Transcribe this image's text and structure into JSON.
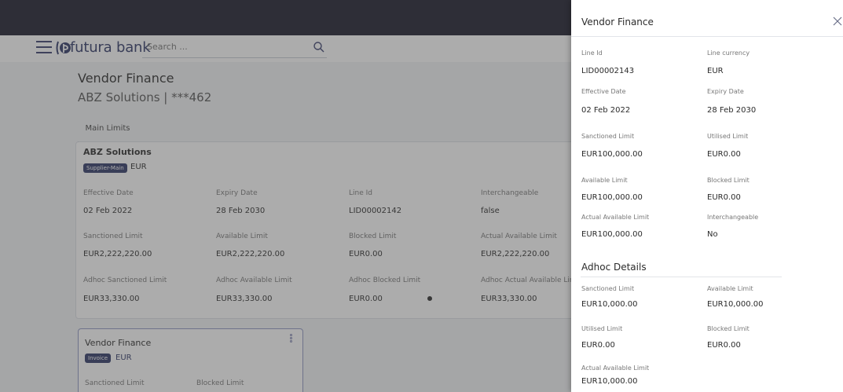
{
  "header": {
    "brand": "futura bank",
    "search_placeholder": "Search ..."
  },
  "page": {
    "title": "Vendor Finance",
    "subtitle": "ABZ Solutions | ***462",
    "tab": "Main Limits"
  },
  "main_card": {
    "title": "ABZ Solutions",
    "badge": "Supplier-Main",
    "currency": "EUR",
    "fields": [
      {
        "label": "Effective Date",
        "value": "02 Feb 2022"
      },
      {
        "label": "Expiry Date",
        "value": "28 Feb 2030"
      },
      {
        "label": "Line Id",
        "value": "LID00002142"
      },
      {
        "label": "Interchangeable",
        "value": "false"
      },
      {
        "label": "Sanctioned Limit",
        "value": "EUR2,222,220.00"
      },
      {
        "label": "Available Limit",
        "value": "EUR2,222,220.00"
      },
      {
        "label": "Blocked Limit",
        "value": "EUR0.00"
      },
      {
        "label": "Actual Available Limit",
        "value": "EUR2,222,220.00"
      },
      {
        "label": "Adhoc Sanctioned Limit",
        "value": "EUR33,330.00"
      },
      {
        "label": "Adhoc Available Limit",
        "value": "EUR33,330.00"
      },
      {
        "label": "Adhoc Blocked Limit",
        "value": "EUR0.00"
      },
      {
        "label": "Adhoc Actual Available Limi",
        "value": "EUR33,330.00"
      }
    ]
  },
  "vendor_card": {
    "title": "Vendor Finance",
    "badge": "Invoice",
    "currency": "EUR",
    "labels": [
      "Sanctioned Limit",
      "Blocked Limit"
    ]
  },
  "drawer": {
    "title": "Vendor Finance",
    "fields": [
      {
        "label": "Line Id",
        "value": "LID00002143"
      },
      {
        "label": "Line currency",
        "value": "EUR"
      },
      {
        "label": "Effective Date",
        "value": "02 Feb 2022"
      },
      {
        "label": "Expiry Date",
        "value": "28 Feb 2030"
      },
      {
        "label": "Sanctioned Limit",
        "value": "EUR100,000.00"
      },
      {
        "label": "Utilised Limit",
        "value": "EUR0.00"
      },
      {
        "label": "Available Limit",
        "value": "EUR100,000.00"
      },
      {
        "label": "Blocked Limit",
        "value": "EUR0.00"
      },
      {
        "label": "Actual Available Limit",
        "value": "EUR100,000.00"
      },
      {
        "label": "Interchangeable",
        "value": "No"
      }
    ],
    "adhoc_title": "Adhoc Details",
    "adhoc_fields": [
      {
        "label": "Sanctioned Limit",
        "value": "EUR10,000.00"
      },
      {
        "label": "Available Limit",
        "value": "EUR10,000.00"
      },
      {
        "label": "Utilised Limit",
        "value": "EUR0.00"
      },
      {
        "label": "Blocked Limit",
        "value": "EUR0.00"
      },
      {
        "label": "Actual Available Limit",
        "value": "EUR10,000.00"
      }
    ]
  },
  "colors": {
    "topbar": "#1b1b2b",
    "brand": "#2f3766",
    "badge": "#2f3766",
    "overlay": "#464646"
  }
}
